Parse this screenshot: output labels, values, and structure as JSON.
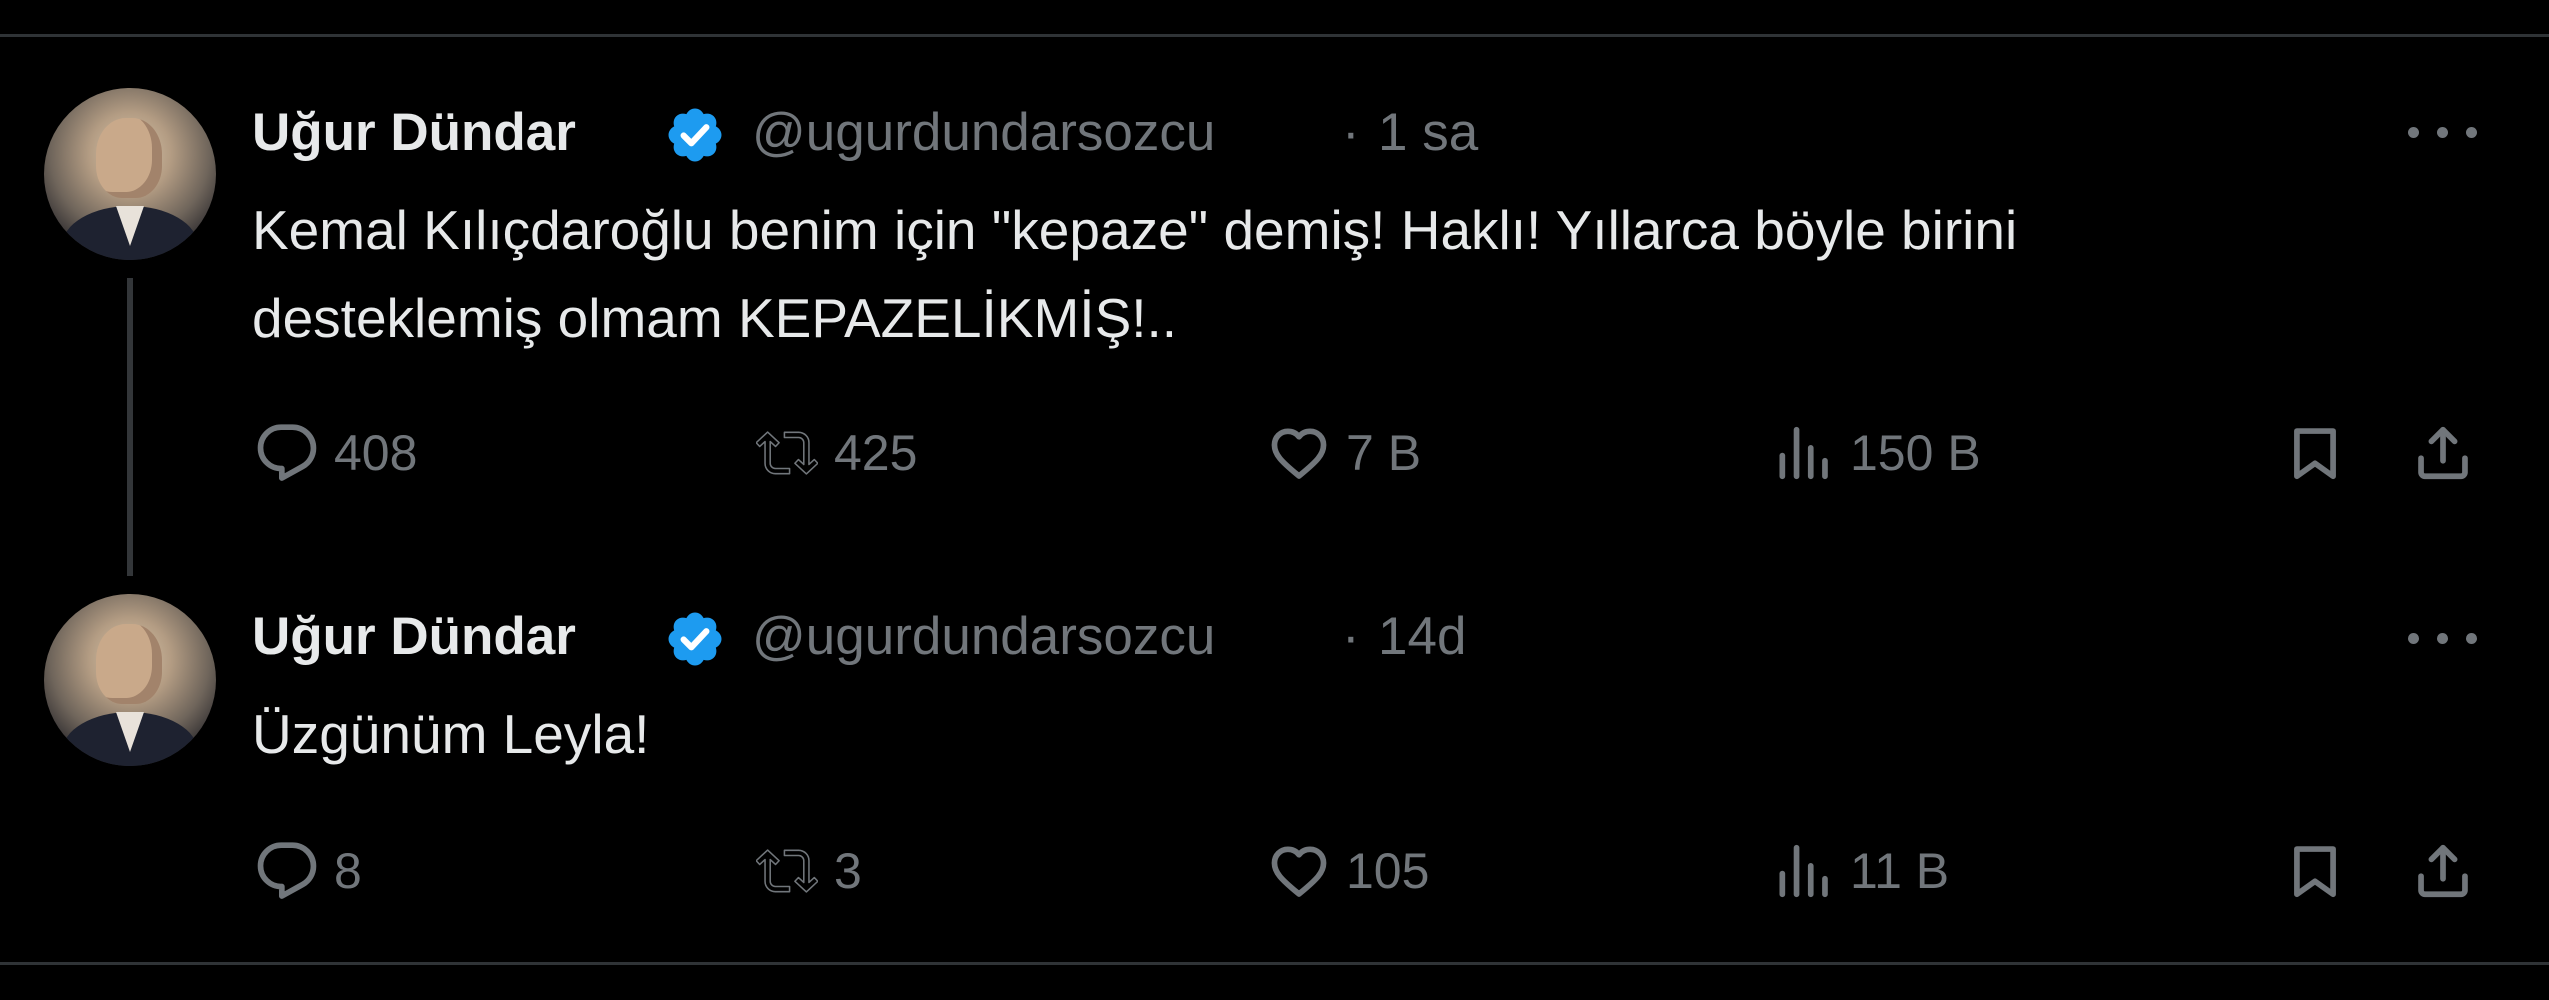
{
  "tweets": [
    {
      "author_name": "Uğur Dündar",
      "handle": "@ugurdundarsozcu",
      "separator": "·",
      "time": "1 sa",
      "text_lines": [
        "Kemal Kılıçdaroğlu benim için \"kepaze\" demiş! Haklı! Yıllarca böyle birini",
        "desteklemiş olmam KEPAZELİKMİŞ!.."
      ],
      "replies": "408",
      "retweets": "425",
      "likes": "7 B",
      "views": "150 B"
    },
    {
      "author_name": "Uğur Dündar",
      "handle": "@ugurdundarsozcu",
      "separator": "·",
      "time": "14d",
      "text_lines": [
        "Üzgünüm Leyla!"
      ],
      "replies": "8",
      "retweets": "3",
      "likes": "105",
      "views": "11 B"
    }
  ],
  "icons": {
    "verified": "verified-badge-icon",
    "more": "more-options-icon",
    "reply": "reply-icon",
    "retweet": "retweet-icon",
    "like": "heart-icon",
    "views": "views-chart-icon",
    "bookmark": "bookmark-icon",
    "share": "share-icon"
  },
  "colors": {
    "background": "#000000",
    "text": "#e7e9ea",
    "muted": "#71767b",
    "verified": "#1d9bf0",
    "divider": "#2f3336"
  }
}
